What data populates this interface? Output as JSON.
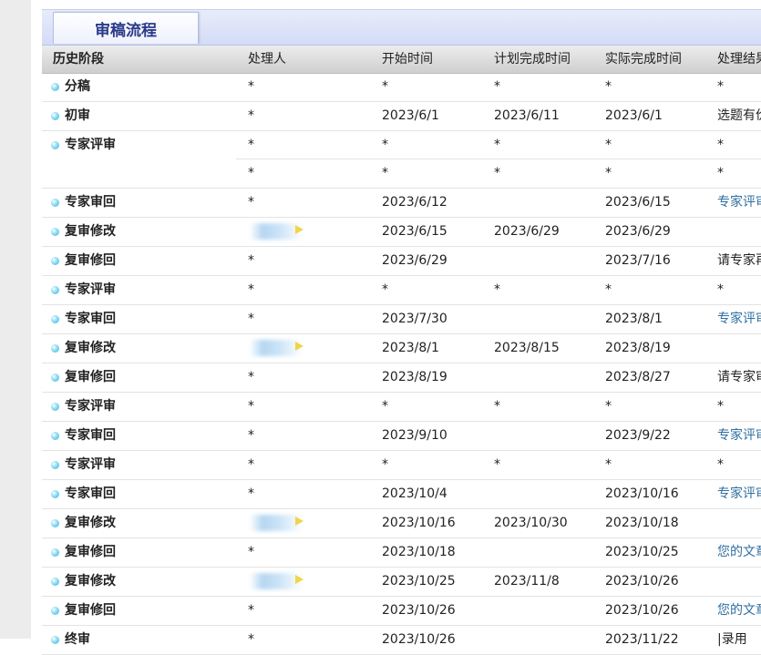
{
  "tab_title": "审稿流程",
  "columns": [
    "历史阶段",
    "处理人",
    "开始时间",
    "计划完成时间",
    "实际完成时间",
    "处理结果"
  ],
  "rows": [
    {
      "stage": "分稿",
      "handler": "*",
      "start": "*",
      "plan": "*",
      "actual": "*",
      "result": "*"
    },
    {
      "stage": "初审",
      "handler": "*",
      "start": "2023/6/1",
      "plan": "2023/6/11",
      "actual": "2023/6/1",
      "result": "选题有价值"
    },
    {
      "stage": "专家评审",
      "handler": "*",
      "start": "*",
      "plan": "*",
      "actual": "*",
      "result": "*"
    },
    {
      "stage": "",
      "handler": "*",
      "start": "*",
      "plan": "*",
      "actual": "*",
      "result": "*"
    },
    {
      "stage": "专家审回",
      "handler": "*",
      "start": "2023/6/12",
      "plan": "",
      "actual": "2023/6/15",
      "result": "专家评审意见",
      "link": true
    },
    {
      "stage": "复审修改",
      "handler": "",
      "start": "2023/6/15",
      "plan": "2023/6/29",
      "actual": "2023/6/29",
      "result": "",
      "blurred": true
    },
    {
      "stage": "复审修回",
      "handler": "*",
      "start": "2023/6/29",
      "plan": "",
      "actual": "2023/7/16",
      "result": "请专家再审"
    },
    {
      "stage": "专家评审",
      "handler": "*",
      "start": "*",
      "plan": "*",
      "actual": "*",
      "result": "*"
    },
    {
      "stage": "专家审回",
      "handler": "*",
      "start": "2023/7/30",
      "plan": "",
      "actual": "2023/8/1",
      "result": "专家评审意见",
      "link": true
    },
    {
      "stage": "复审修改",
      "handler": "",
      "start": "2023/8/1",
      "plan": "2023/8/15",
      "actual": "2023/8/19",
      "result": "",
      "blurred": true
    },
    {
      "stage": "复审修回",
      "handler": "*",
      "start": "2023/8/19",
      "plan": "",
      "actual": "2023/8/27",
      "result": "请专家审"
    },
    {
      "stage": "专家评审",
      "handler": "*",
      "start": "*",
      "plan": "*",
      "actual": "*",
      "result": "*"
    },
    {
      "stage": "专家审回",
      "handler": "*",
      "start": "2023/9/10",
      "plan": "",
      "actual": "2023/9/22",
      "result": "专家评审意见",
      "link": true
    },
    {
      "stage": "专家评审",
      "handler": "*",
      "start": "*",
      "plan": "*",
      "actual": "*",
      "result": "*"
    },
    {
      "stage": "专家审回",
      "handler": "*",
      "start": "2023/10/4",
      "plan": "",
      "actual": "2023/10/16",
      "result": "专家评审意见",
      "link": true
    },
    {
      "stage": "复审修改",
      "handler": "",
      "start": "2023/10/16",
      "plan": "2023/10/30",
      "actual": "2023/10/18",
      "result": "",
      "blurred": true
    },
    {
      "stage": "复审修回",
      "handler": "*",
      "start": "2023/10/18",
      "plan": "",
      "actual": "2023/10/25",
      "result": "您的文章",
      "link": true
    },
    {
      "stage": "复审修改",
      "handler": "",
      "start": "2023/10/25",
      "plan": "2023/11/8",
      "actual": "2023/10/26",
      "result": "",
      "blurred": true
    },
    {
      "stage": "复审修回",
      "handler": "*",
      "start": "2023/10/26",
      "plan": "",
      "actual": "2023/10/26",
      "result": "您的文章",
      "link": true
    },
    {
      "stage": "终审",
      "handler": "*",
      "start": "2023/10/26",
      "plan": "",
      "actual": "2023/11/22",
      "result": "|录用"
    }
  ]
}
